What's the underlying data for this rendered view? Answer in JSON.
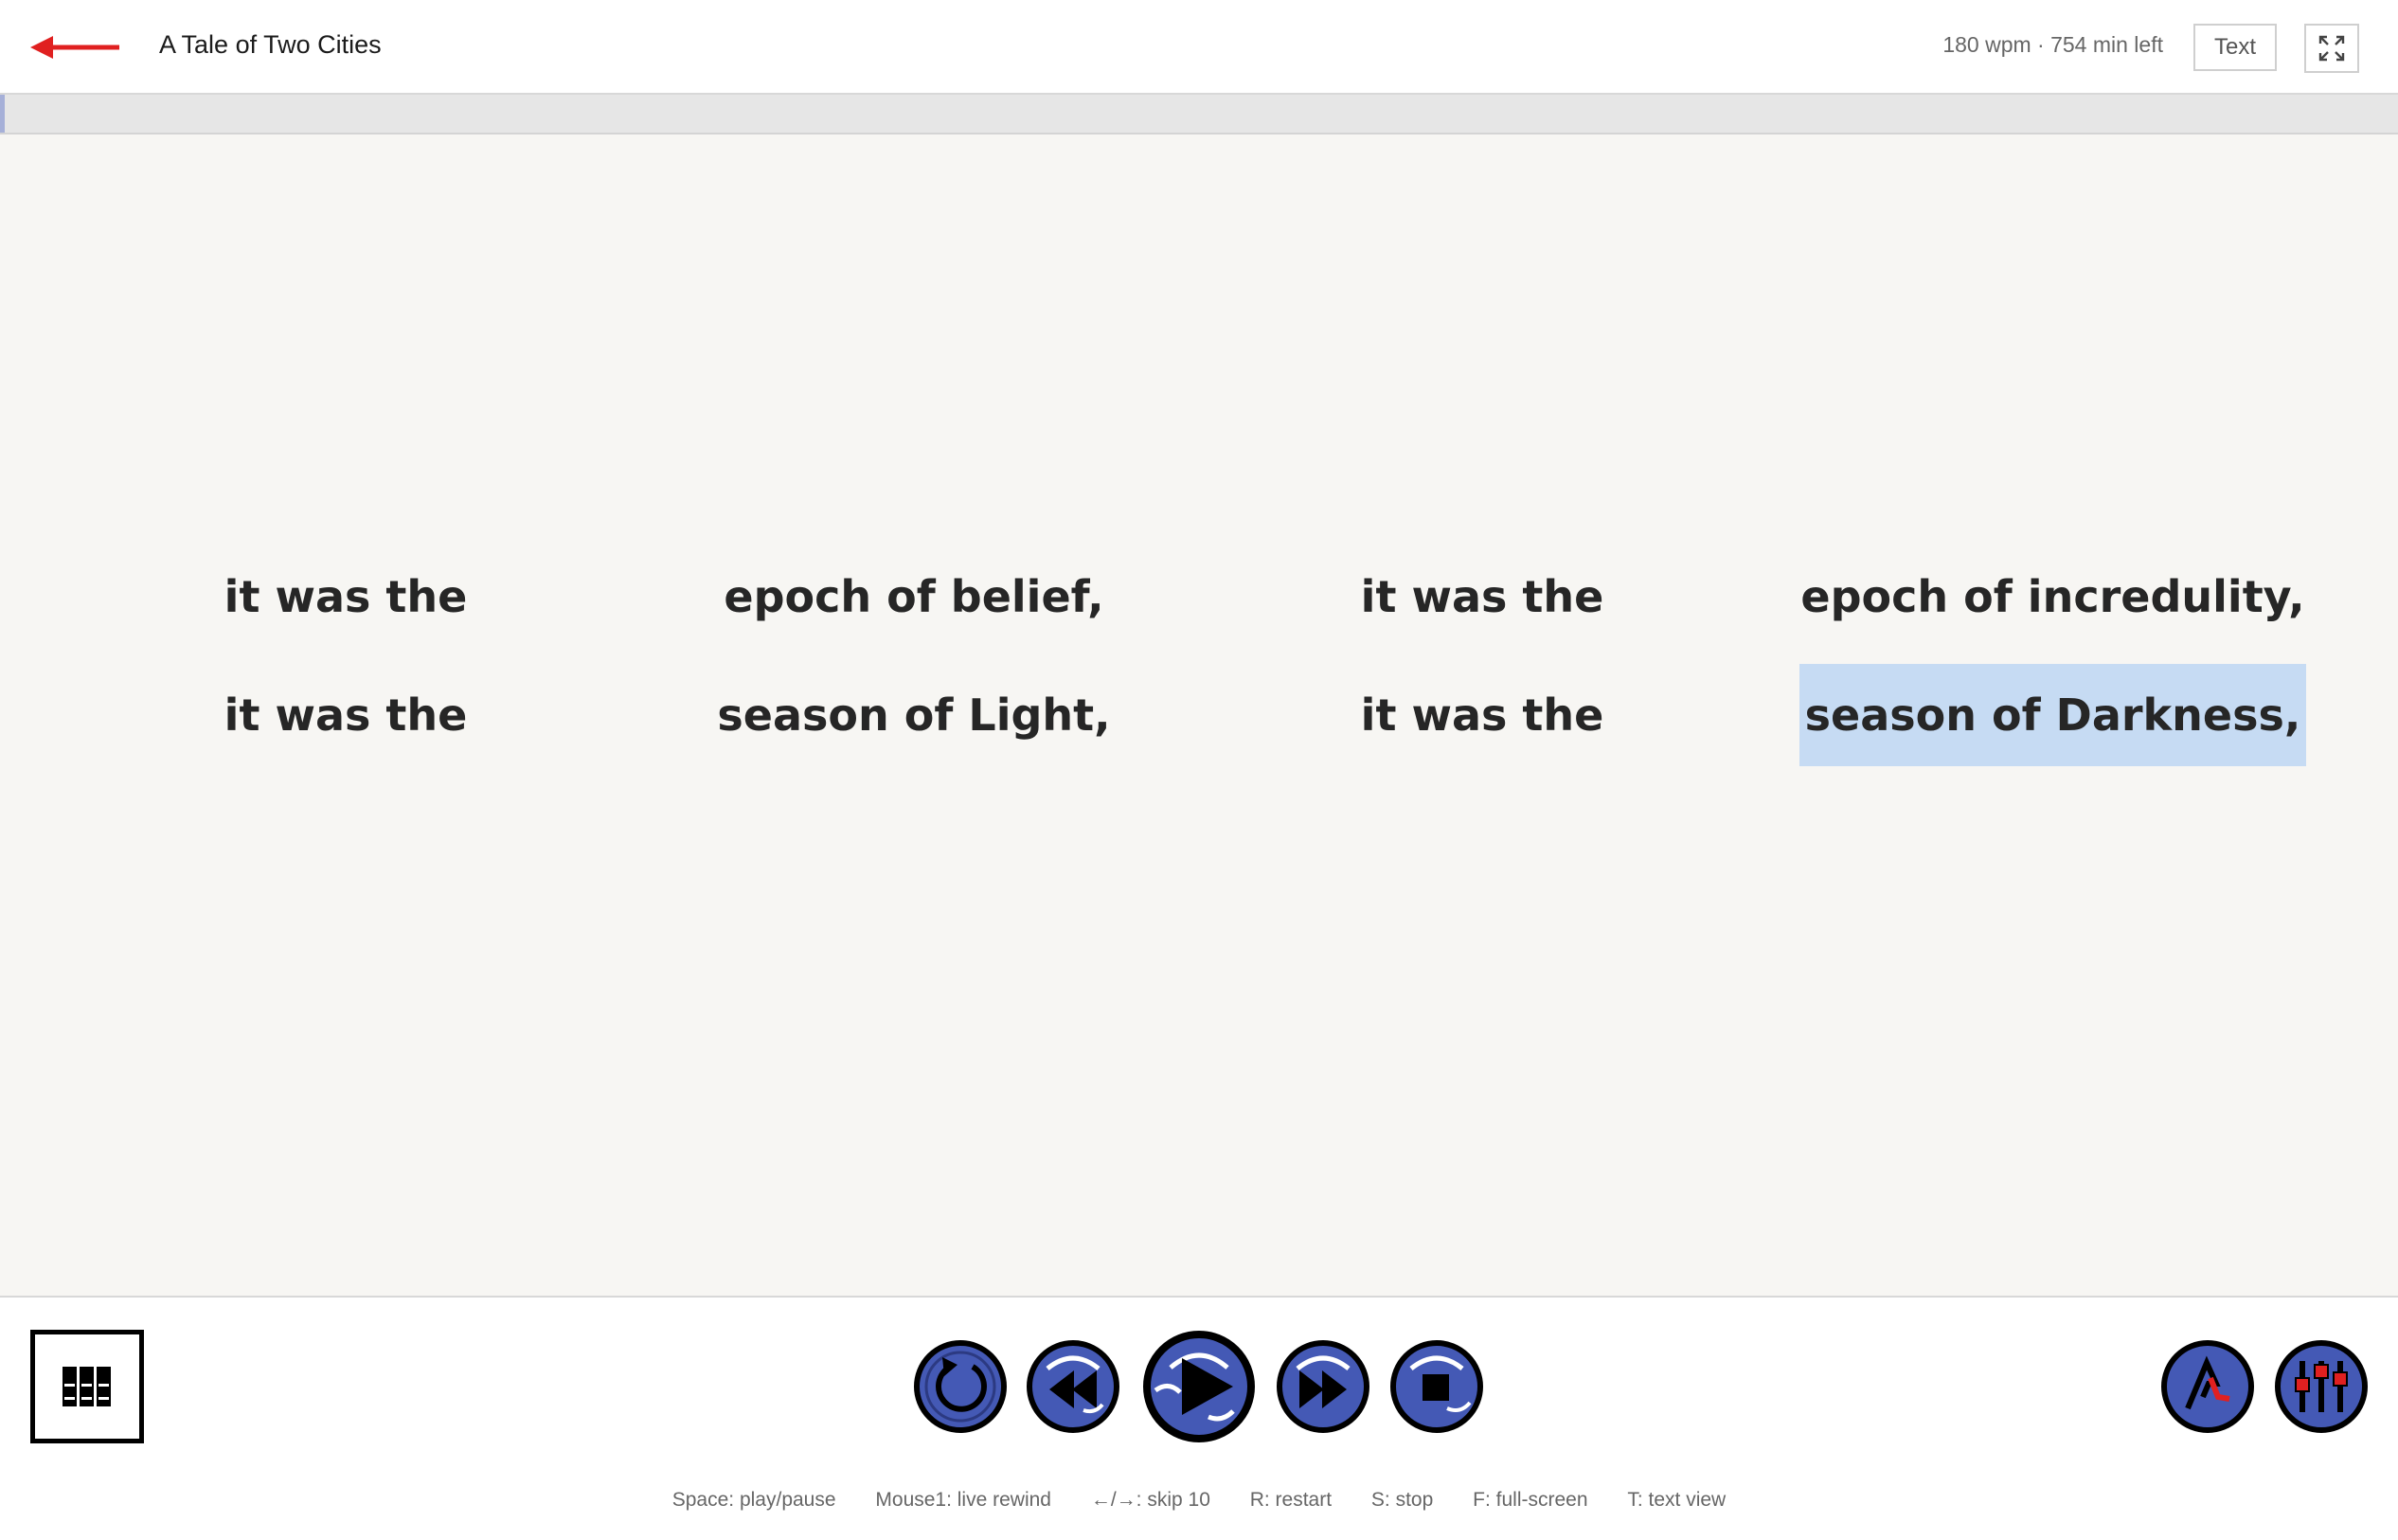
{
  "header": {
    "title": "A Tale of Two Cities",
    "stats": "180 wpm · 754 min left",
    "text_button": "Text"
  },
  "progress": {
    "fraction": 0.002
  },
  "reader": {
    "lines": [
      [
        "it was the",
        "epoch of belief,",
        "it was the",
        "epoch of incredulity,"
      ],
      [
        "it was the",
        "season of Light,",
        "it was the",
        "season of Darkness,"
      ]
    ],
    "active_phrase": "season of Darkness,"
  },
  "footer": {
    "shortcuts": [
      "Space: play/pause",
      "Mouse1: live rewind",
      "←/→: skip 10",
      "R: restart",
      "S: stop",
      "F: full-screen",
      "T: text view"
    ]
  },
  "colors": {
    "accent_blue": "#4459b5",
    "highlight": "#c6dbf3",
    "back_arrow": "#e02020",
    "progress_fill": "#a6b0d8"
  }
}
